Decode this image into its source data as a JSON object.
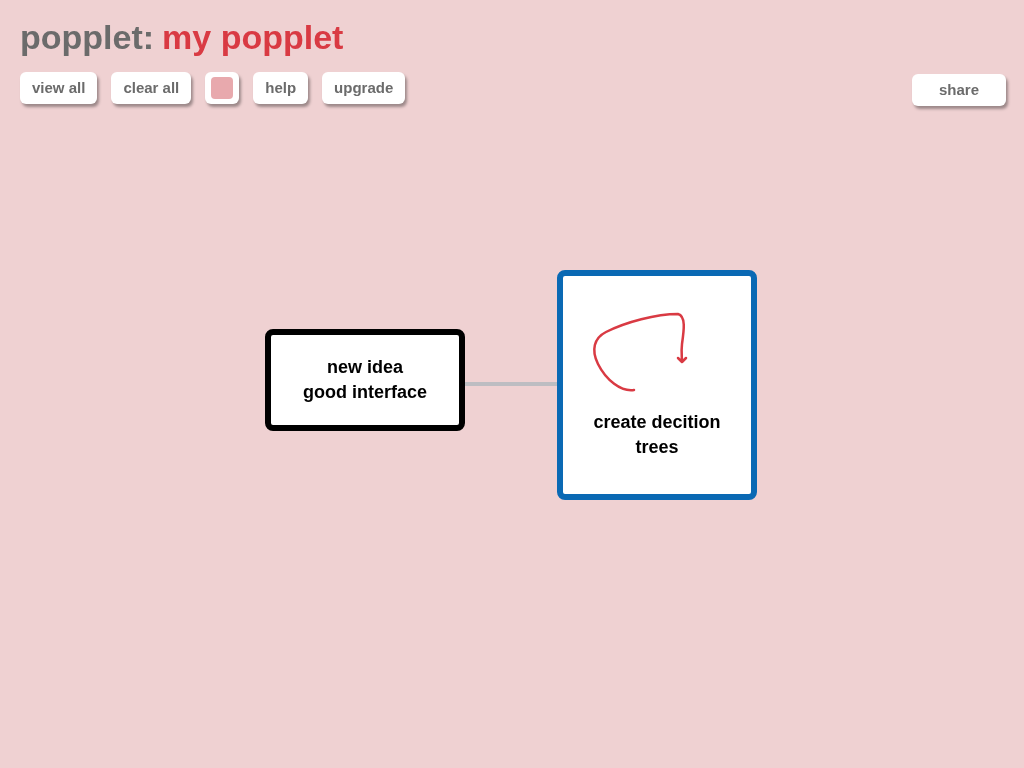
{
  "header": {
    "app": "popplet:",
    "title": "my popplet"
  },
  "toolbar": [
    {
      "kind": "button",
      "label": "view all"
    },
    {
      "kind": "button",
      "label": "clear all"
    },
    {
      "kind": "swatch",
      "color": "#e8a9ad"
    },
    {
      "kind": "button",
      "label": "help"
    },
    {
      "kind": "button",
      "label": "upgrade"
    }
  ],
  "share": {
    "label": "share"
  },
  "canvas": {
    "nodes": [
      {
        "text": "new idea\ngood interface",
        "color": "#000000",
        "drawing": false
      },
      {
        "text": "create decition\ntrees",
        "color": "#0a69b4",
        "drawing": true
      }
    ]
  }
}
